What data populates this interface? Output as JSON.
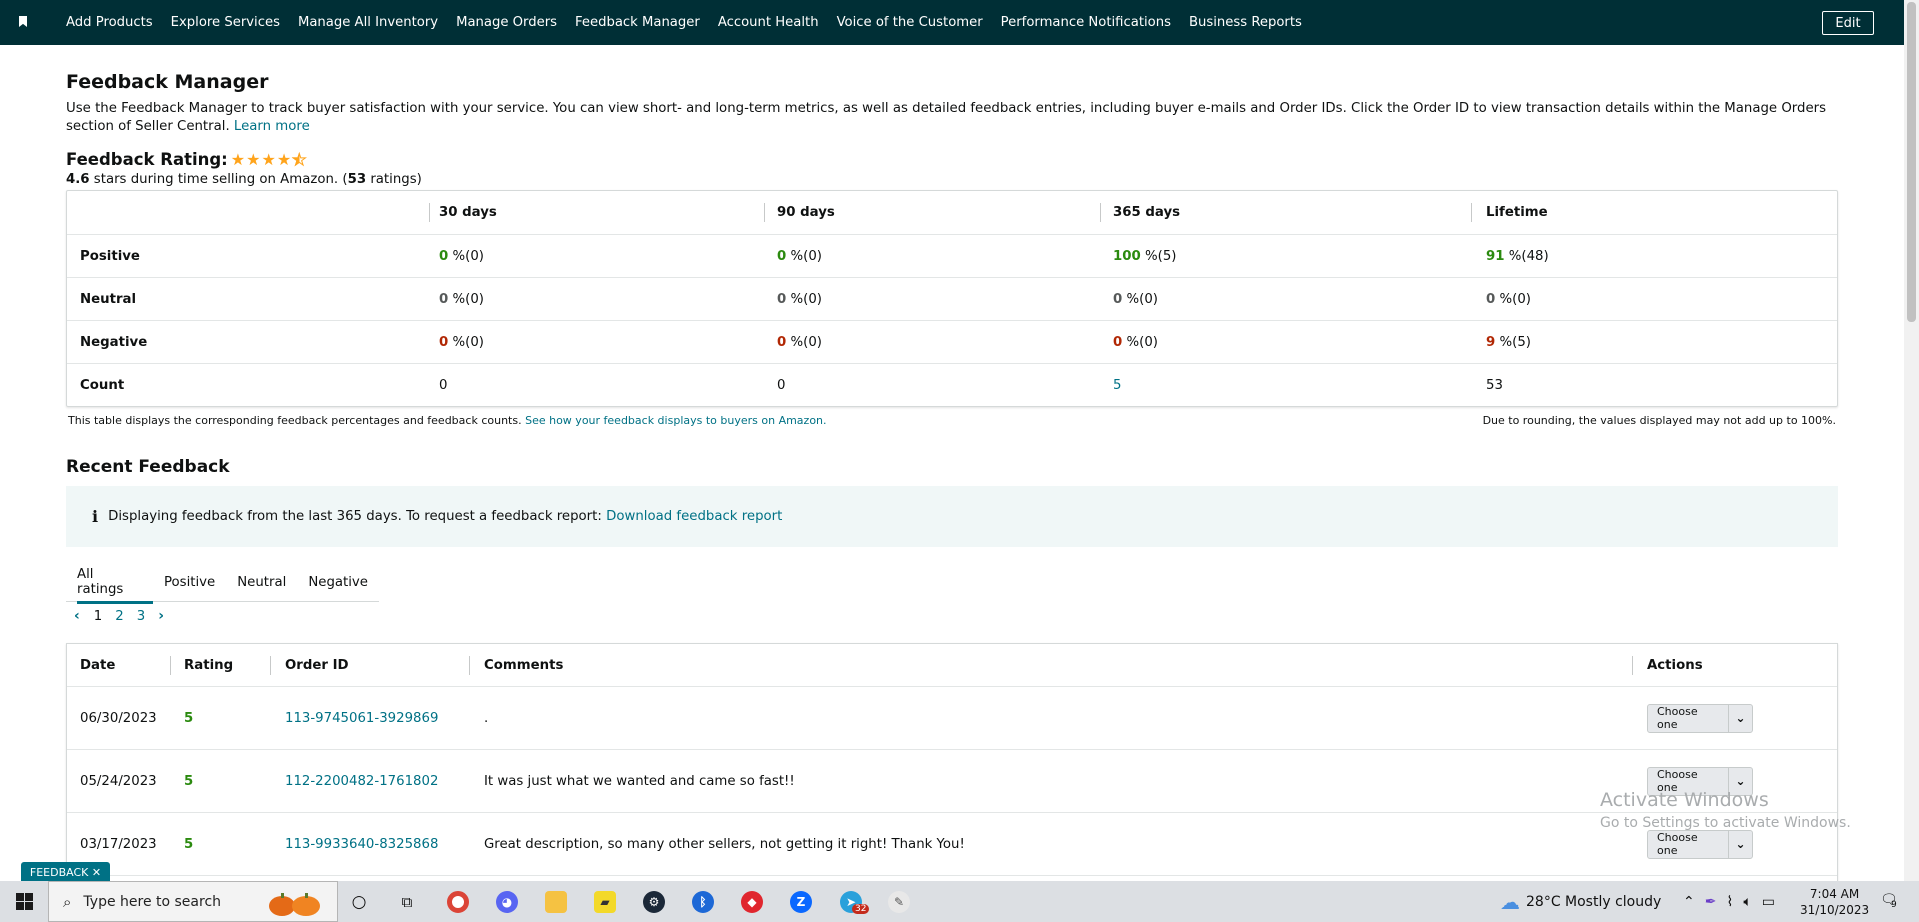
{
  "topnav": {
    "links": [
      "Add Products",
      "Explore Services",
      "Manage All Inventory",
      "Manage Orders",
      "Feedback Manager",
      "Account Health",
      "Voice of the Customer",
      "Performance Notifications",
      "Business Reports"
    ],
    "edit_label": "Edit"
  },
  "page": {
    "title": "Feedback Manager",
    "intro": "Use the Feedback Manager to track buyer satisfaction with your service. You can view short- and long-term metrics, as well as detailed feedback entries, including buyer e-mails and Order IDs. Click the Order ID to view transaction details within the Manage Orders section of Seller Central.",
    "learn_more": "Learn more"
  },
  "rating": {
    "label": "Feedback Rating:",
    "stars": 4.5,
    "value": "4.6",
    "sub_text": "stars during time selling on Amazon. (",
    "count": "53",
    "count_suffix": "ratings)"
  },
  "metrics": {
    "headers": [
      "30 days",
      "90 days",
      "365 days",
      "Lifetime"
    ],
    "rows": [
      {
        "label": "Positive",
        "values": [
          [
            "0",
            "%(0)"
          ],
          [
            "0",
            "%(0)"
          ],
          [
            "100",
            "%(5)"
          ],
          [
            "91",
            "%(48)"
          ]
        ]
      },
      {
        "label": "Neutral",
        "values": [
          [
            "0",
            "%(0)"
          ],
          [
            "0",
            "%(0)"
          ],
          [
            "0",
            "%(0)"
          ],
          [
            "0",
            "%(0)"
          ]
        ]
      },
      {
        "label": "Negative",
        "values": [
          [
            "0",
            "%(0)"
          ],
          [
            "0",
            "%(0)"
          ],
          [
            "0",
            "%(0)"
          ],
          [
            "9",
            "%(5)"
          ]
        ]
      },
      {
        "label": "Count",
        "values": [
          "0",
          "0",
          "5",
          "53"
        ]
      }
    ],
    "note_left": "This table displays the corresponding feedback percentages and feedback counts.",
    "note_link": "See how your feedback displays to buyers on Amazon.",
    "note_right": "Due to rounding, the values displayed may not add up to 100%."
  },
  "recent": {
    "title": "Recent Feedback",
    "info_icon": "i",
    "info_text": "Displaying feedback from the last 365 days. To request a feedback report:",
    "info_link": "Download feedback report",
    "tabs": [
      "All ratings",
      "Positive",
      "Neutral",
      "Negative"
    ],
    "pages": [
      "1",
      "2",
      "3"
    ],
    "columns": [
      "Date",
      "Rating",
      "Order ID",
      "Comments",
      "Actions"
    ],
    "rows": [
      {
        "date": "06/30/2023",
        "rating": "5",
        "order": "113-9745061-3929869",
        "comment": ".",
        "action": "Choose one"
      },
      {
        "date": "05/24/2023",
        "rating": "5",
        "order": "112-2200482-1761802",
        "comment": "It was just what we wanted and came so fast!!",
        "action": "Choose one"
      },
      {
        "date": "03/17/2023",
        "rating": "5",
        "order": "113-9933640-8325868",
        "comment": "Great description, so many other sellers, not getting it right! Thank You!",
        "action": "Choose one"
      }
    ]
  },
  "feedback_tab": "FEEDBACK",
  "watermark": {
    "line1": "Activate Windows",
    "line2": "Go to Settings to activate Windows."
  },
  "taskbar": {
    "search_placeholder": "Type here to search",
    "weather": "28°C  Mostly cloudy",
    "time": "7:04 AM",
    "date": "31/10/2023",
    "badge_32": "32",
    "notif_count": "9"
  },
  "colors": {
    "nav_bg": "#002f36",
    "link": "#007185",
    "positive": "#2b8a0f",
    "negative": "#b12704",
    "info_bg": "#f0f7f7"
  }
}
